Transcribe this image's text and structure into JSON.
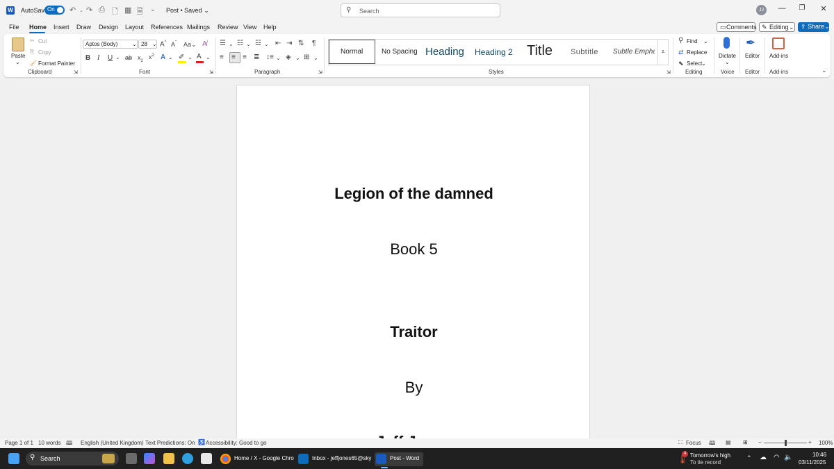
{
  "titlebar": {
    "autosave_label": "AutoSave",
    "autosave_state": "On",
    "doc_title": "Post • Saved",
    "search_placeholder": "Search",
    "avatar_initials": "JJ"
  },
  "menu": {
    "tabs": [
      "File",
      "Home",
      "Insert",
      "Draw",
      "Design",
      "Layout",
      "References",
      "Mailings",
      "Review",
      "View",
      "Help"
    ],
    "active": "Home",
    "comments": "Comments",
    "editing": "Editing",
    "share": "Share"
  },
  "ribbon": {
    "clipboard": {
      "paste": "Paste",
      "cut": "Cut",
      "copy": "Copy",
      "format_painter": "Format Painter",
      "label": "Clipboard"
    },
    "font": {
      "name": "Aptos (Body)",
      "size": "28",
      "label": "Font"
    },
    "paragraph": {
      "label": "Paragraph"
    },
    "styles": {
      "items": [
        "Normal",
        "No Spacing",
        "Heading",
        "Heading 2",
        "Title",
        "Subtitle",
        "Subtle Empha"
      ],
      "label": "Styles"
    },
    "editing": {
      "find": "Find",
      "replace": "Replace",
      "select": "Select",
      "label": "Editing"
    },
    "voice": {
      "dictate": "Dictate",
      "label": "Voice"
    },
    "editor": {
      "editor": "Editor",
      "label": "Editor"
    },
    "addins": {
      "addins": "Add-ins",
      "label": "Add-ins"
    }
  },
  "document": {
    "line1": "Legion of the damned",
    "line2": "Book 5",
    "line3": "Traitor",
    "line4": "By",
    "line5": "Jeff Jones"
  },
  "status": {
    "page": "Page 1 of 1",
    "words": "10 words",
    "language": "English (United Kingdom)",
    "predictions": "Text Predictions: On",
    "accessibility": "Accessibility: Good to go",
    "focus": "Focus",
    "zoom": "100%",
    "zoom_level": 1.0
  },
  "taskbar": {
    "search": "Search",
    "chrome": "Home / X - Google Chro",
    "outlook": "Inbox - jeffjones65@sky",
    "word": "Post - Word",
    "weather_title": "Tomorrow's high",
    "weather_sub": "To tie record",
    "weather_badge": "4",
    "time": "10:46",
    "date": "03/11/2025"
  }
}
